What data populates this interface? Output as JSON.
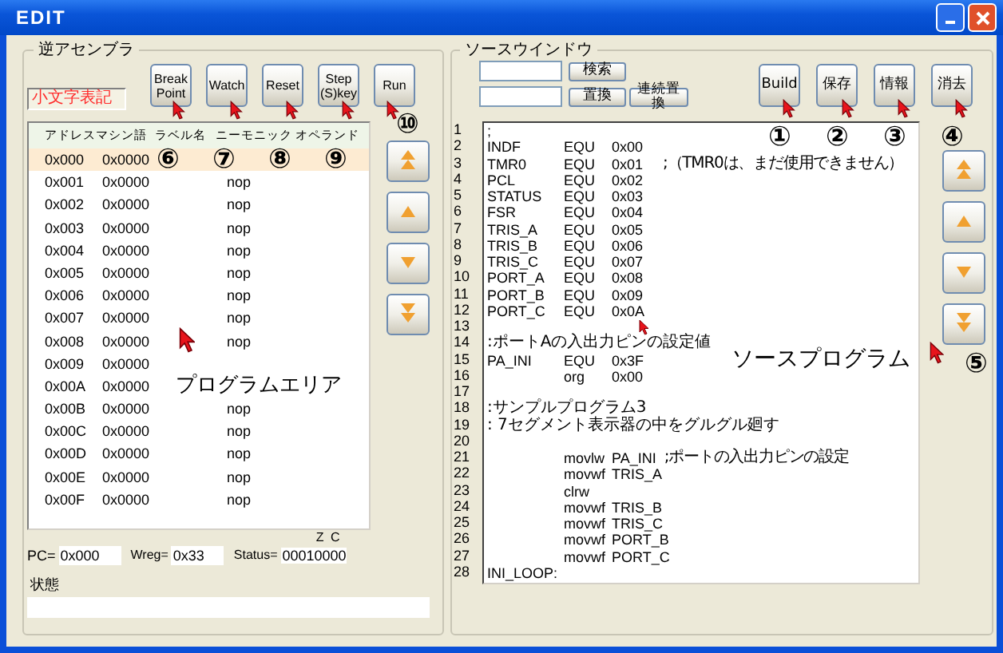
{
  "window": {
    "title": "EDIT"
  },
  "disassembler": {
    "title": "逆アセンブラ",
    "case_label": "小文字表記",
    "buttons": [
      {
        "label": "Break\nPoint",
        "callout": "⑥"
      },
      {
        "label": "Watch",
        "callout": "⑦"
      },
      {
        "label": "Reset",
        "callout": "⑧"
      },
      {
        "label": "Step\n(S)key",
        "callout": "⑨"
      },
      {
        "label": "Run",
        "callout": "⑩"
      }
    ],
    "columns": [
      "アドレス",
      "マシン語",
      "ラベル名",
      "ニーモニック",
      "オペランド"
    ],
    "rows": [
      {
        "address": "0x000",
        "machine": "0x0000",
        "selected": true
      },
      {
        "address": "0x001",
        "machine": "0x0000",
        "mnemonic": "nop",
        "selected": false
      },
      {
        "address": "0x002",
        "machine": "0x0000",
        "mnemonic": "nop",
        "selected": false
      },
      {
        "address": "0x003",
        "machine": "0x0000",
        "mnemonic": "nop",
        "selected": false
      },
      {
        "address": "0x004",
        "machine": "0x0000",
        "mnemonic": "nop",
        "selected": false
      },
      {
        "address": "0x005",
        "machine": "0x0000",
        "mnemonic": "nop",
        "selected": false
      },
      {
        "address": "0x006",
        "machine": "0x0000",
        "mnemonic": "nop",
        "selected": false
      },
      {
        "address": "0x007",
        "machine": "0x0000",
        "mnemonic": "nop",
        "selected": false
      },
      {
        "address": "0x008",
        "machine": "0x0000",
        "mnemonic": "nop",
        "selected": false
      },
      {
        "address": "0x009",
        "machine": "0x0000",
        "selected": false
      },
      {
        "address": "0x00A",
        "machine": "0x0000",
        "selected": false
      },
      {
        "address": "0x00B",
        "machine": "0x0000",
        "mnemonic": "nop",
        "selected": false
      },
      {
        "address": "0x00C",
        "machine": "0x0000",
        "mnemonic": "nop",
        "selected": false
      },
      {
        "address": "0x00D",
        "machine": "0x0000",
        "mnemonic": "nop",
        "selected": false
      },
      {
        "address": "0x00E",
        "machine": "0x0000",
        "mnemonic": "nop",
        "selected": false
      },
      {
        "address": "0x00F",
        "machine": "0x0000",
        "mnemonic": "nop",
        "selected": false
      }
    ],
    "overlay_label": "プログラムエリア"
  },
  "registers": {
    "pc_label": "PC=",
    "pc": "0x000",
    "wreg_label": "Wreg=",
    "wreg": "0x33",
    "status_label": "Status=",
    "status": "00010000",
    "flag_labels": "Z C",
    "state_label": "状態"
  },
  "source": {
    "title": "ソースウインドウ",
    "search_button": "検索",
    "replace_button": "置換",
    "replace_all_button": "連続置換",
    "buttons": [
      {
        "label": "Build",
        "callout": "①"
      },
      {
        "label": "保存",
        "callout": "②"
      },
      {
        "label": "情報",
        "callout": "③"
      },
      {
        "label": "消去",
        "callout": "④"
      }
    ],
    "nav_callout": "⑤",
    "lines": [
      {
        "number": "1",
        "label": ";"
      },
      {
        "number": "2",
        "label": "INDF",
        "op": "EQU",
        "arg": "0x00"
      },
      {
        "number": "3",
        "label": "TMR0",
        "op": "EQU",
        "arg": "0x01",
        "comment": ";（TMR0は、まだ使用できません）"
      },
      {
        "number": "4",
        "label": "PCL",
        "op": "EQU",
        "arg": "0x02"
      },
      {
        "number": "5",
        "label": "STATUS",
        "op": "EQU",
        "arg": "0x03"
      },
      {
        "number": "6",
        "label": "FSR",
        "op": "EQU",
        "arg": "0x04"
      },
      {
        "number": "7",
        "label": "TRIS_A",
        "op": "EQU",
        "arg": "0x05"
      },
      {
        "number": "8",
        "label": "TRIS_B",
        "op": "EQU",
        "arg": "0x06"
      },
      {
        "number": "9",
        "label": "TRIS_C",
        "op": "EQU",
        "arg": "0x07"
      },
      {
        "number": "10",
        "label": "PORT_A",
        "op": "EQU",
        "arg": "0x08"
      },
      {
        "number": "11",
        "label": "PORT_B",
        "op": "EQU",
        "arg": "0x09"
      },
      {
        "number": "12",
        "label": "PORT_C",
        "op": "EQU",
        "arg": "0x0A"
      },
      {
        "number": "13"
      },
      {
        "number": "14",
        "comment": ":ポートAの入出力ピンの設定値"
      },
      {
        "number": "15",
        "label": "PA_INI",
        "op": "EQU",
        "arg": "0x3F"
      },
      {
        "number": "16",
        "op": "org",
        "arg": "0x00"
      },
      {
        "number": "17"
      },
      {
        "number": "18",
        "comment": ":サンプルプログラム3"
      },
      {
        "number": "19",
        "comment": ": 7セグメント表示器の中をグルグル廻す"
      },
      {
        "number": "20"
      },
      {
        "number": "21",
        "op": "movlw",
        "arg": "PA_INI",
        "comment": ";ポートの入出力ピンの設定"
      },
      {
        "number": "22",
        "op": "movwf",
        "arg": "TRIS_A"
      },
      {
        "number": "23",
        "op": "clrw"
      },
      {
        "number": "24",
        "op": "movwf",
        "arg": "TRIS_B"
      },
      {
        "number": "25",
        "op": "movwf",
        "arg": "TRIS_C"
      },
      {
        "number": "26",
        "op": "movwf",
        "arg": "PORT_B"
      },
      {
        "number": "27",
        "op": "movwf",
        "arg": "PORT_C"
      },
      {
        "number": "28",
        "label": "INI_LOOP:"
      }
    ],
    "overlay_label": "ソースプログラム"
  }
}
